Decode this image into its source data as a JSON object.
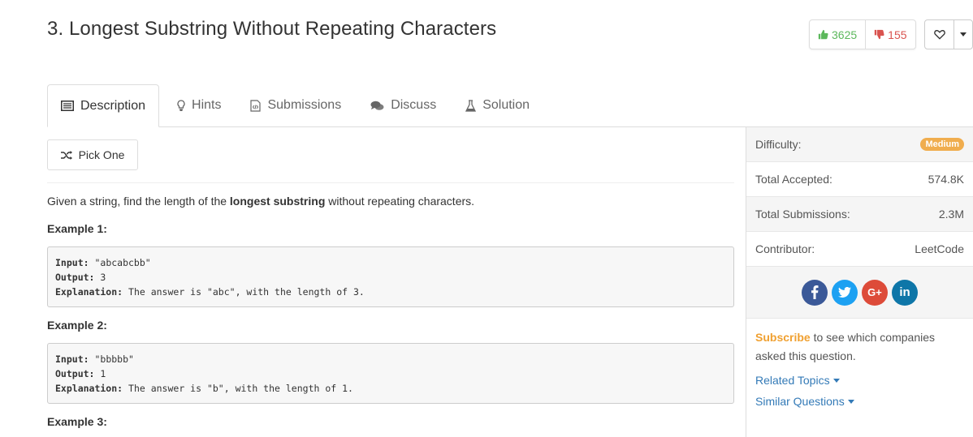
{
  "problem": {
    "title": "3. Longest Substring Without Repeating Characters",
    "upvotes": "3625",
    "downvotes": "155"
  },
  "tabs": [
    {
      "label": "Description",
      "icon": "list-icon"
    },
    {
      "label": "Hints",
      "icon": "lightbulb-icon"
    },
    {
      "label": "Submissions",
      "icon": "code-file-icon"
    },
    {
      "label": "Discuss",
      "icon": "comments-icon"
    },
    {
      "label": "Solution",
      "icon": "flask-icon"
    }
  ],
  "pick_one": "Pick One",
  "description": {
    "before": "Given a string, find the length of the ",
    "bold": "longest substring",
    "after": " without repeating characters."
  },
  "examples": [
    {
      "heading": "Example 1:",
      "input_label": "Input:",
      "input": " \"abcabcbb\"",
      "output_label": "Output:",
      "output": " 3",
      "expl_label": "Explanation:",
      "expl": " The answer is \"abc\", with the length of 3."
    },
    {
      "heading": "Example 2:",
      "input_label": "Input:",
      "input": " \"bbbbb\"",
      "output_label": "Output:",
      "output": " 1",
      "expl_label": "Explanation:",
      "expl": " The answer is \"b\", with the length of 1."
    },
    {
      "heading": "Example 3:"
    }
  ],
  "sidebar": {
    "difficulty_label": "Difficulty:",
    "difficulty": "Medium",
    "accepted_label": "Total Accepted:",
    "accepted": "574.8K",
    "submissions_label": "Total Submissions:",
    "submissions": "2.3M",
    "contributor_label": "Contributor:",
    "contributor": "LeetCode",
    "social": [
      {
        "name": "facebook",
        "glyph": "f",
        "color": "#3b5998"
      },
      {
        "name": "twitter",
        "glyph": "t",
        "color": "#1da1f2"
      },
      {
        "name": "google-plus",
        "glyph": "G+",
        "color": "#dd4b39"
      },
      {
        "name": "linkedin",
        "glyph": "in",
        "color": "#0e76a8"
      }
    ],
    "subscribe": "Subscribe",
    "subscribe_rest": " to see which companies asked this question.",
    "related_topics": "Related Topics",
    "similar_questions": "Similar Questions"
  },
  "colors": {
    "accent": "#337ab7",
    "upvote": "#5cb85c",
    "downvote": "#d9534f",
    "medium": "#f0ad4e"
  }
}
